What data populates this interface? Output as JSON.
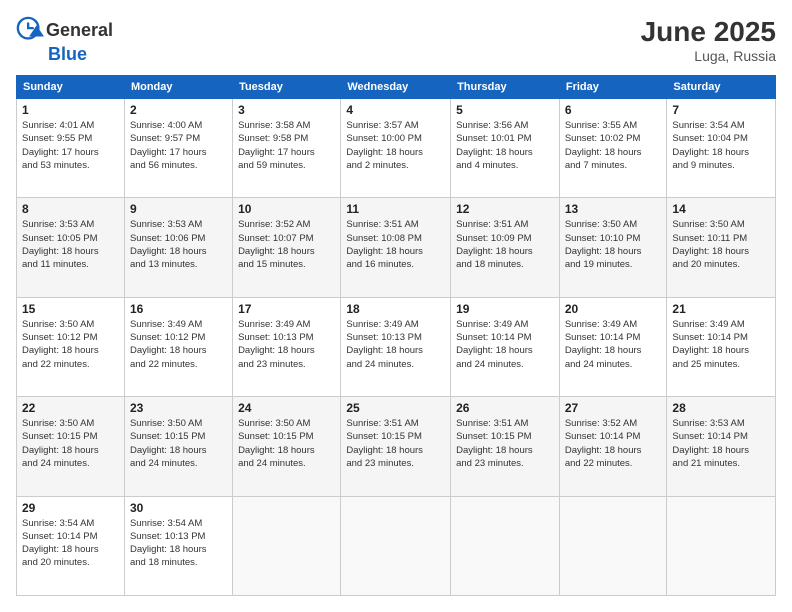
{
  "header": {
    "logo_general": "General",
    "logo_blue": "Blue",
    "month_title": "June 2025",
    "location": "Luga, Russia"
  },
  "days_of_week": [
    "Sunday",
    "Monday",
    "Tuesday",
    "Wednesday",
    "Thursday",
    "Friday",
    "Saturday"
  ],
  "weeks": [
    [
      {
        "day": "1",
        "info": "Sunrise: 4:01 AM\nSunset: 9:55 PM\nDaylight: 17 hours\nand 53 minutes."
      },
      {
        "day": "2",
        "info": "Sunrise: 4:00 AM\nSunset: 9:57 PM\nDaylight: 17 hours\nand 56 minutes."
      },
      {
        "day": "3",
        "info": "Sunrise: 3:58 AM\nSunset: 9:58 PM\nDaylight: 17 hours\nand 59 minutes."
      },
      {
        "day": "4",
        "info": "Sunrise: 3:57 AM\nSunset: 10:00 PM\nDaylight: 18 hours\nand 2 minutes."
      },
      {
        "day": "5",
        "info": "Sunrise: 3:56 AM\nSunset: 10:01 PM\nDaylight: 18 hours\nand 4 minutes."
      },
      {
        "day": "6",
        "info": "Sunrise: 3:55 AM\nSunset: 10:02 PM\nDaylight: 18 hours\nand 7 minutes."
      },
      {
        "day": "7",
        "info": "Sunrise: 3:54 AM\nSunset: 10:04 PM\nDaylight: 18 hours\nand 9 minutes."
      }
    ],
    [
      {
        "day": "8",
        "info": "Sunrise: 3:53 AM\nSunset: 10:05 PM\nDaylight: 18 hours\nand 11 minutes."
      },
      {
        "day": "9",
        "info": "Sunrise: 3:53 AM\nSunset: 10:06 PM\nDaylight: 18 hours\nand 13 minutes."
      },
      {
        "day": "10",
        "info": "Sunrise: 3:52 AM\nSunset: 10:07 PM\nDaylight: 18 hours\nand 15 minutes."
      },
      {
        "day": "11",
        "info": "Sunrise: 3:51 AM\nSunset: 10:08 PM\nDaylight: 18 hours\nand 16 minutes."
      },
      {
        "day": "12",
        "info": "Sunrise: 3:51 AM\nSunset: 10:09 PM\nDaylight: 18 hours\nand 18 minutes."
      },
      {
        "day": "13",
        "info": "Sunrise: 3:50 AM\nSunset: 10:10 PM\nDaylight: 18 hours\nand 19 minutes."
      },
      {
        "day": "14",
        "info": "Sunrise: 3:50 AM\nSunset: 10:11 PM\nDaylight: 18 hours\nand 20 minutes."
      }
    ],
    [
      {
        "day": "15",
        "info": "Sunrise: 3:50 AM\nSunset: 10:12 PM\nDaylight: 18 hours\nand 22 minutes."
      },
      {
        "day": "16",
        "info": "Sunrise: 3:49 AM\nSunset: 10:12 PM\nDaylight: 18 hours\nand 22 minutes."
      },
      {
        "day": "17",
        "info": "Sunrise: 3:49 AM\nSunset: 10:13 PM\nDaylight: 18 hours\nand 23 minutes."
      },
      {
        "day": "18",
        "info": "Sunrise: 3:49 AM\nSunset: 10:13 PM\nDaylight: 18 hours\nand 24 minutes."
      },
      {
        "day": "19",
        "info": "Sunrise: 3:49 AM\nSunset: 10:14 PM\nDaylight: 18 hours\nand 24 minutes."
      },
      {
        "day": "20",
        "info": "Sunrise: 3:49 AM\nSunset: 10:14 PM\nDaylight: 18 hours\nand 24 minutes."
      },
      {
        "day": "21",
        "info": "Sunrise: 3:49 AM\nSunset: 10:14 PM\nDaylight: 18 hours\nand 25 minutes."
      }
    ],
    [
      {
        "day": "22",
        "info": "Sunrise: 3:50 AM\nSunset: 10:15 PM\nDaylight: 18 hours\nand 24 minutes."
      },
      {
        "day": "23",
        "info": "Sunrise: 3:50 AM\nSunset: 10:15 PM\nDaylight: 18 hours\nand 24 minutes."
      },
      {
        "day": "24",
        "info": "Sunrise: 3:50 AM\nSunset: 10:15 PM\nDaylight: 18 hours\nand 24 minutes."
      },
      {
        "day": "25",
        "info": "Sunrise: 3:51 AM\nSunset: 10:15 PM\nDaylight: 18 hours\nand 23 minutes."
      },
      {
        "day": "26",
        "info": "Sunrise: 3:51 AM\nSunset: 10:15 PM\nDaylight: 18 hours\nand 23 minutes."
      },
      {
        "day": "27",
        "info": "Sunrise: 3:52 AM\nSunset: 10:14 PM\nDaylight: 18 hours\nand 22 minutes."
      },
      {
        "day": "28",
        "info": "Sunrise: 3:53 AM\nSunset: 10:14 PM\nDaylight: 18 hours\nand 21 minutes."
      }
    ],
    [
      {
        "day": "29",
        "info": "Sunrise: 3:54 AM\nSunset: 10:14 PM\nDaylight: 18 hours\nand 20 minutes."
      },
      {
        "day": "30",
        "info": "Sunrise: 3:54 AM\nSunset: 10:13 PM\nDaylight: 18 hours\nand 18 minutes."
      },
      {
        "day": "",
        "info": ""
      },
      {
        "day": "",
        "info": ""
      },
      {
        "day": "",
        "info": ""
      },
      {
        "day": "",
        "info": ""
      },
      {
        "day": "",
        "info": ""
      }
    ]
  ]
}
